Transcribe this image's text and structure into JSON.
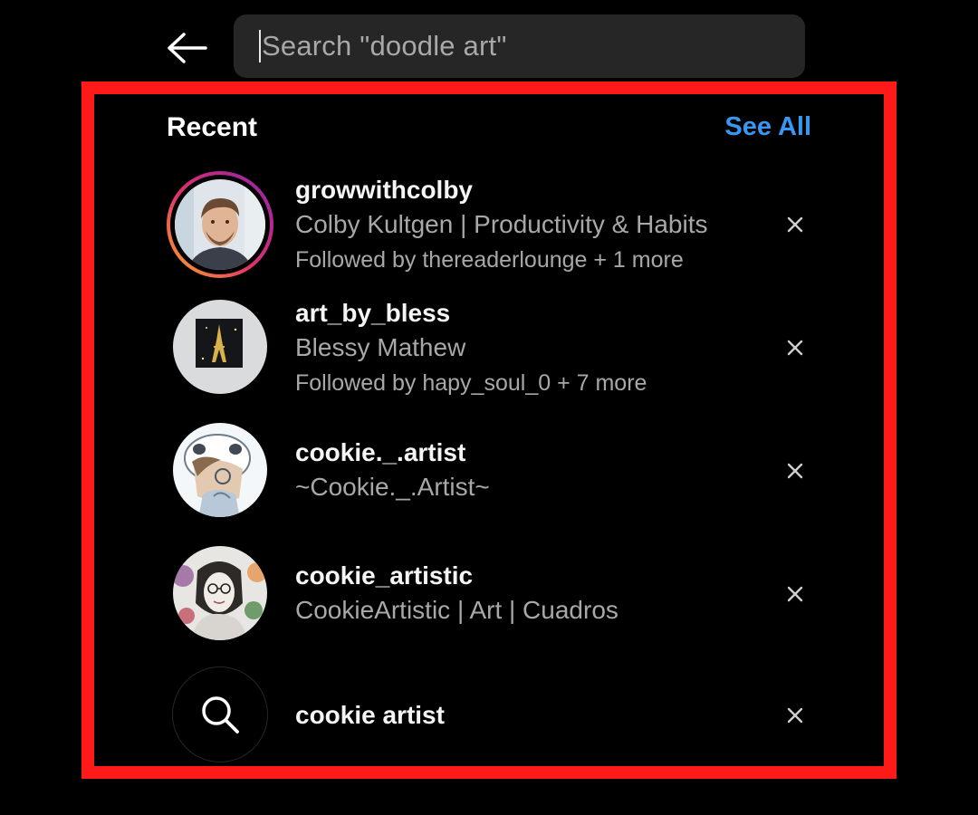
{
  "search": {
    "placeholder": "Search \"doodle art\""
  },
  "recent": {
    "title": "Recent",
    "see_all": "See All",
    "items": [
      {
        "username": "growwithcolby",
        "full_name": "Colby Kultgen | Productivity & Habits",
        "followed_by": "Followed by thereaderlounge + 1 more",
        "avatar": "profile-photo-man",
        "has_story_ring": true
      },
      {
        "username": "art_by_bless",
        "full_name": "Blessy Mathew",
        "followed_by": "Followed by hapy_soul_0 + 7 more",
        "avatar": "eiffel-tower-artwork"
      },
      {
        "username": "cookie._.artist",
        "full_name": "~Cookie._.Artist~",
        "avatar": "panda-hood-drawing"
      },
      {
        "username": "cookie_artistic",
        "full_name": "CookieArtistic | Art | Cuadros",
        "avatar": "floral-portrait-drawing"
      },
      {
        "query": "cookie artist",
        "icon": "search-icon"
      }
    ]
  },
  "icons": {
    "back": "arrow-left-icon",
    "remove": "close-icon"
  },
  "colors": {
    "background": "#000000",
    "accent_link": "#3897f0",
    "highlight_border": "#ff1a1a",
    "secondary_text": "#a8a8a8",
    "search_field": "#262626"
  }
}
